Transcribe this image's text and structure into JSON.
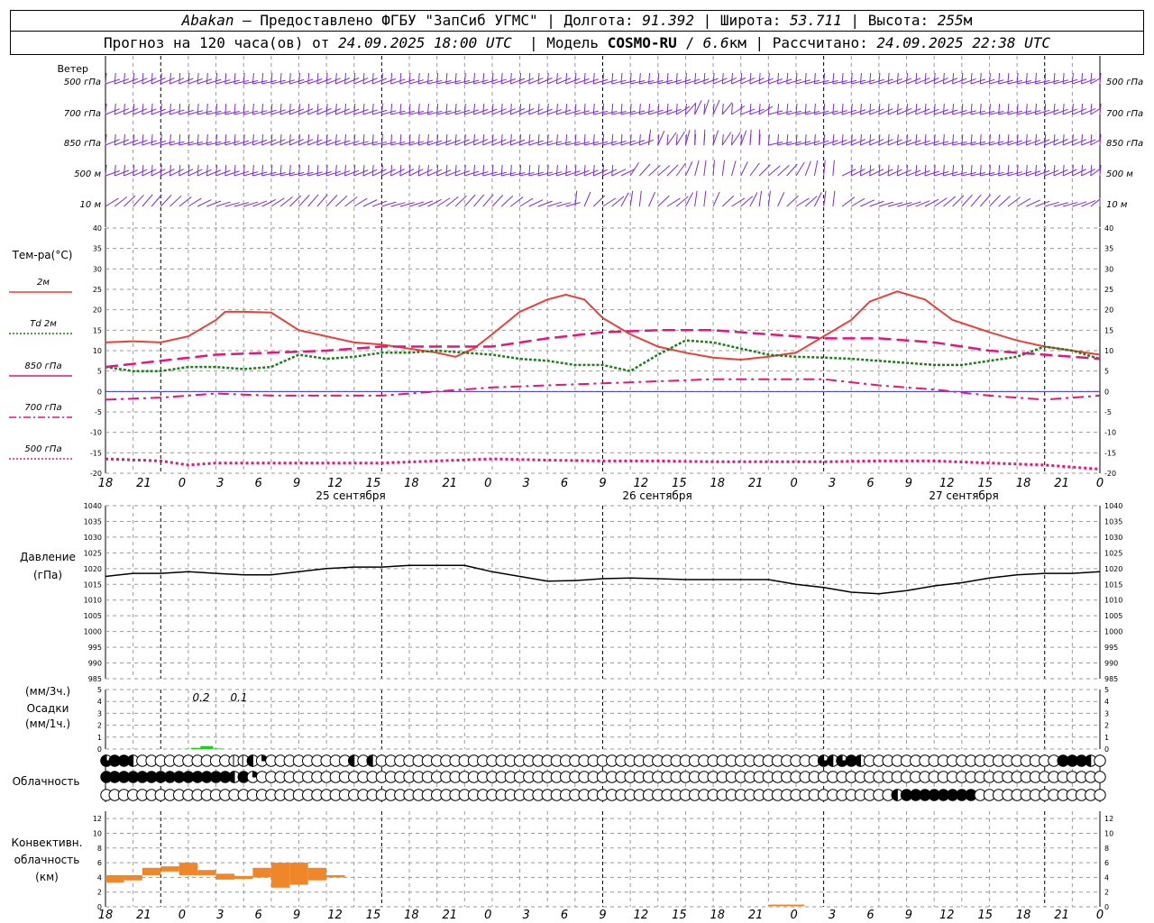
{
  "header": {
    "city": "Abakan",
    "provided_by": "— Предоставлено ФГБУ \"ЗапСиб УГМС\"",
    "lon_label": "Долгота:",
    "lon_value": "91.392",
    "lat_label": "Широта:",
    "lat_value": "53.711",
    "alt_label": "Высота:",
    "alt_value": "255",
    "alt_unit": "м",
    "forecast_prefix": "Прогноз на 120 часа(ов) от",
    "forecast_start": "24.09.2025 18:00 UTC",
    "model_label": "Модель",
    "model_name": "COSMO-RU",
    "model_res": "6.6",
    "model_res_unit": "км",
    "calc_label": "Рассчитано:",
    "calc_time": "24.09.2025 22:38 UTC"
  },
  "colors": {
    "wind": "#7b2fd1",
    "t2m": "#e8413c",
    "td": "#1e7d1e",
    "magenta": "#e0187a",
    "pressure": "#000000",
    "precip": "#22cc22",
    "conv": "#f0862a",
    "grid": "#9a9a9a",
    "zero": "#3a3ad8"
  },
  "labels": {
    "wind_title": "Ветер",
    "wind_levels": [
      "500 гПа",
      "700 гПа",
      "850 гПа",
      "500 м",
      "10 м"
    ],
    "temp_title": "Тем-ра(°C)",
    "temp_legend": [
      "2м",
      "Td  2м",
      "850 гПа",
      "700 гПа",
      "500 гПа"
    ],
    "pressure_title": "Давление",
    "pressure_unit": "(гПа)",
    "precip_unit3": "(мм/3ч.)",
    "precip_title": "Осадки",
    "precip_unit1": "(мм/1ч.)",
    "cloud_title": "Облачность",
    "conv_title": [
      "Конвективн.",
      "облачность",
      "(км)"
    ]
  },
  "time_axis": {
    "ticks": [
      "18",
      "21",
      "0",
      "3",
      "6",
      "9",
      "12",
      "15",
      "18",
      "21",
      "0",
      "3",
      "6",
      "9",
      "12",
      "15",
      "18",
      "21",
      "0",
      "3",
      "6",
      "9",
      "12",
      "15",
      "18",
      "21",
      "0"
    ],
    "dates": [
      "25 сентября",
      "26 сентября",
      "27 сентября"
    ]
  },
  "chart_data": [
    {
      "type": "line",
      "title": "Тем-ра(°C)",
      "ylim": [
        -20,
        40
      ],
      "yticks": [
        -20,
        -15,
        -10,
        -5,
        0,
        5,
        10,
        15,
        20,
        25,
        30,
        35,
        40
      ],
      "x_hours": "hours from 24.09.2025 18:00 UTC",
      "series": [
        {
          "name": "2м",
          "points": [
            [
              0,
              12
            ],
            [
              3,
              12.3
            ],
            [
              6,
              12
            ],
            [
              9,
              13.5
            ],
            [
              12,
              17.5
            ],
            [
              13,
              19.5
            ],
            [
              15,
              19.5
            ],
            [
              18,
              19.3
            ],
            [
              21,
              15
            ],
            [
              24,
              13.5
            ],
            [
              27,
              12
            ],
            [
              30,
              11.5
            ],
            [
              33,
              10.5
            ],
            [
              36,
              9.5
            ],
            [
              38,
              8.5
            ],
            [
              40,
              10.5
            ],
            [
              42,
              14
            ],
            [
              45,
              19.5
            ],
            [
              48,
              22.5
            ],
            [
              50,
              23.7
            ],
            [
              52,
              22.5
            ],
            [
              54,
              18
            ],
            [
              57,
              14
            ],
            [
              60,
              11
            ],
            [
              63,
              9.5
            ],
            [
              66,
              8.3
            ],
            [
              69,
              7.8
            ],
            [
              72,
              8.5
            ],
            [
              75,
              9.5
            ],
            [
              78,
              13.5
            ],
            [
              81,
              17.5
            ],
            [
              83,
              22
            ],
            [
              86,
              24.5
            ],
            [
              89,
              22.5
            ],
            [
              92,
              17.5
            ],
            [
              96,
              14.5
            ],
            [
              99,
              12.5
            ],
            [
              102,
              11
            ],
            [
              105,
              10
            ],
            [
              108,
              9
            ]
          ]
        },
        {
          "name": "Td  2м",
          "points": [
            [
              0,
              6
            ],
            [
              3,
              5
            ],
            [
              6,
              5
            ],
            [
              9,
              6
            ],
            [
              12,
              6
            ],
            [
              15,
              5.5
            ],
            [
              18,
              6
            ],
            [
              21,
              9
            ],
            [
              24,
              8
            ],
            [
              27,
              8.5
            ],
            [
              30,
              9.5
            ],
            [
              33,
              9.5
            ],
            [
              36,
              10
            ],
            [
              39,
              9.5
            ],
            [
              42,
              9
            ],
            [
              45,
              8
            ],
            [
              48,
              7.5
            ],
            [
              51,
              6.5
            ],
            [
              54,
              6.5
            ],
            [
              57,
              5
            ],
            [
              60,
              9
            ],
            [
              63,
              12.5
            ],
            [
              66,
              12
            ],
            [
              69,
              10.5
            ],
            [
              72,
              9
            ],
            [
              75,
              8.5
            ],
            [
              78,
              8.3
            ],
            [
              81,
              8
            ],
            [
              84,
              7.5
            ],
            [
              87,
              7
            ],
            [
              90,
              6.5
            ],
            [
              93,
              6.5
            ],
            [
              96,
              7.5
            ],
            [
              99,
              8.5
            ],
            [
              102,
              11
            ],
            [
              105,
              10
            ],
            [
              108,
              8
            ]
          ]
        },
        {
          "name": "850 гПа",
          "points": [
            [
              0,
              6
            ],
            [
              6,
              7.5
            ],
            [
              12,
              9
            ],
            [
              18,
              9.5
            ],
            [
              24,
              10
            ],
            [
              30,
              11
            ],
            [
              36,
              11
            ],
            [
              42,
              11
            ],
            [
              48,
              13
            ],
            [
              54,
              14.5
            ],
            [
              60,
              15
            ],
            [
              66,
              15
            ],
            [
              72,
              14
            ],
            [
              78,
              13
            ],
            [
              84,
              13
            ],
            [
              90,
              12
            ],
            [
              96,
              10
            ],
            [
              102,
              9
            ],
            [
              108,
              8
            ]
          ]
        },
        {
          "name": "700 гПа",
          "points": [
            [
              0,
              -2
            ],
            [
              6,
              -1.5
            ],
            [
              12,
              -0.5
            ],
            [
              18,
              -1
            ],
            [
              24,
              -1
            ],
            [
              30,
              -1
            ],
            [
              36,
              0
            ],
            [
              42,
              1
            ],
            [
              48,
              1.5
            ],
            [
              54,
              2
            ],
            [
              60,
              2.5
            ],
            [
              66,
              3
            ],
            [
              72,
              3
            ],
            [
              78,
              3
            ],
            [
              84,
              1.5
            ],
            [
              90,
              0.5
            ],
            [
              96,
              -1
            ],
            [
              102,
              -2
            ],
            [
              108,
              -1
            ]
          ]
        },
        {
          "name": "500 гПа",
          "points": [
            [
              0,
              -16.5
            ],
            [
              6,
              -17
            ],
            [
              9,
              -18
            ],
            [
              12,
              -17.5
            ],
            [
              18,
              -17.5
            ],
            [
              24,
              -17.5
            ],
            [
              30,
              -17.5
            ],
            [
              36,
              -17
            ],
            [
              42,
              -16.5
            ],
            [
              48,
              -16.8
            ],
            [
              54,
              -17
            ],
            [
              60,
              -17
            ],
            [
              66,
              -17.2
            ],
            [
              72,
              -17.2
            ],
            [
              78,
              -17.2
            ],
            [
              84,
              -17
            ],
            [
              90,
              -17
            ],
            [
              96,
              -17.5
            ],
            [
              102,
              -18
            ],
            [
              108,
              -19
            ]
          ]
        }
      ]
    },
    {
      "type": "line",
      "title": "Давление",
      "ylim": [
        985,
        1040
      ],
      "yticks": [
        985,
        990,
        995,
        1000,
        1005,
        1010,
        1015,
        1020,
        1025,
        1030,
        1035,
        1040
      ],
      "series": [
        {
          "name": "Давление",
          "points": [
            [
              0,
              1017.5
            ],
            [
              3,
              1018.5
            ],
            [
              6,
              1018.5
            ],
            [
              9,
              1019
            ],
            [
              12,
              1018.5
            ],
            [
              15,
              1018
            ],
            [
              18,
              1018
            ],
            [
              21,
              1019
            ],
            [
              24,
              1020
            ],
            [
              27,
              1020.5
            ],
            [
              30,
              1020.5
            ],
            [
              33,
              1021
            ],
            [
              36,
              1021
            ],
            [
              39,
              1021
            ],
            [
              42,
              1019
            ],
            [
              45,
              1017.5
            ],
            [
              48,
              1016
            ],
            [
              51,
              1016.2
            ],
            [
              54,
              1016.8
            ],
            [
              57,
              1017
            ],
            [
              60,
              1016.8
            ],
            [
              63,
              1016.5
            ],
            [
              66,
              1016.5
            ],
            [
              69,
              1016.5
            ],
            [
              72,
              1016.5
            ],
            [
              75,
              1015
            ],
            [
              78,
              1014
            ],
            [
              81,
              1012.5
            ],
            [
              84,
              1012
            ],
            [
              87,
              1013
            ],
            [
              90,
              1014.5
            ],
            [
              93,
              1015.5
            ],
            [
              96,
              1017
            ],
            [
              99,
              1018
            ],
            [
              102,
              1018.5
            ],
            [
              105,
              1018.5
            ],
            [
              108,
              1019
            ]
          ]
        }
      ]
    },
    {
      "type": "bar",
      "title": "Осадки",
      "ylim": [
        0,
        5
      ],
      "yticks": [
        0,
        1,
        2,
        3,
        4,
        5
      ],
      "annotations": [
        "0.2",
        "0.1"
      ],
      "bars": [
        [
          1,
          0.02
        ],
        [
          2,
          0.1
        ],
        [
          3,
          0.25
        ],
        [
          4,
          0.05
        ]
      ]
    },
    {
      "type": "bar",
      "title": "Конвективн. облачность (км)",
      "ylim": [
        0,
        13
      ],
      "yticks": [
        0,
        2,
        4,
        6,
        8,
        10,
        12
      ],
      "bars": [
        [
          0,
          3.3,
          4.3
        ],
        [
          1,
          3.6,
          4.3
        ],
        [
          2,
          4.3,
          5.3
        ],
        [
          3,
          4.8,
          5.5
        ],
        [
          4,
          4.3,
          6.0
        ],
        [
          5,
          4.3,
          5.0
        ],
        [
          6,
          3.7,
          4.5
        ],
        [
          7,
          3.8,
          4.2
        ],
        [
          8,
          4.0,
          5.3
        ],
        [
          9,
          2.6,
          6.0
        ],
        [
          10,
          3.0,
          6.0
        ],
        [
          11,
          3.6,
          5.3
        ],
        [
          12,
          4.0,
          4.3
        ],
        [
          19,
          0.1,
          0.3
        ]
      ]
    }
  ],
  "cloud_rows": {
    "low": "TFFHNNNNNNNNNNSSHQNNNNNNNNNHNHNNNNNNNNNNNNNNNNNNNNNNNNNNNNNNNNNNNNNNNNNNNNNNNNTHTFHNNNNNNNNNNNNNNNNNNNNNFFFHN",
    "mid": "FFFFFFFFFFFFFFHFQNNNNNNNNNNNNNNNNNNNNNNNNNNNNNNNNNNNNNNNNNNNNNNNNNNNNNNNNNNNNNNNNNNNNNNNNNNNNNNNNNNNNNNNNNN",
    "high": "NNNNNNNNNNNNNNNNNNNNNNNNNNNNNNNNNNNNNNNNNNNNNNNNNNNNNNNNNNNNNNNNNNNNNNNNNNNNNNNNNNNNNNHFFFFFFFFNNNNNNNNNNNNNNNNNNNNNNN"
  }
}
